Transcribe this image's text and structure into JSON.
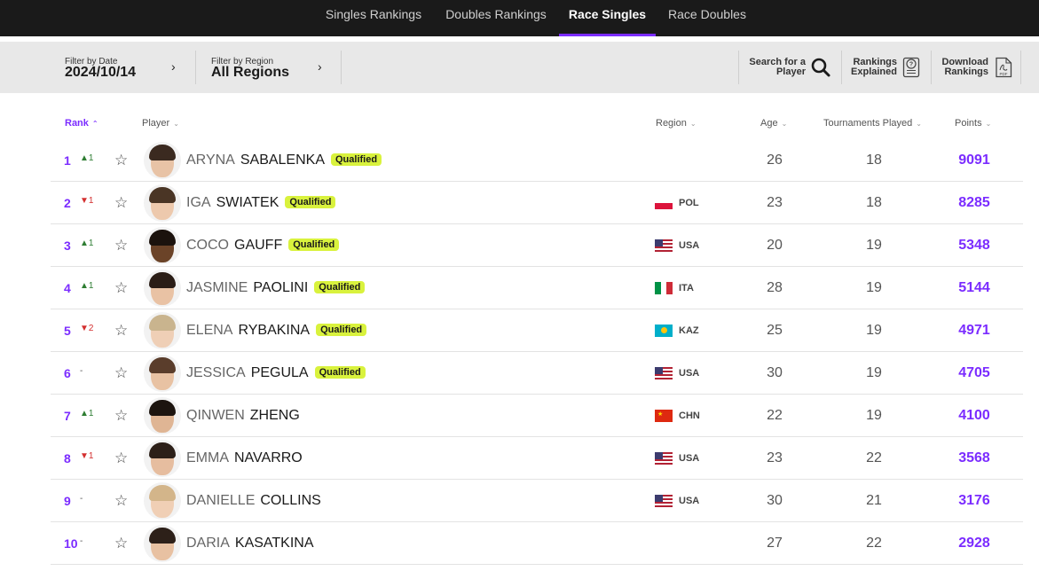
{
  "nav": {
    "tabs": [
      {
        "label": "Singles Rankings",
        "active": false
      },
      {
        "label": "Doubles Rankings",
        "active": false
      },
      {
        "label": "Race Singles",
        "active": true
      },
      {
        "label": "Race Doubles",
        "active": false
      }
    ],
    "accent_color": "#7b2cff"
  },
  "filters": {
    "date_label": "Filter by Date",
    "date_value": "2024/10/14",
    "region_label": "Filter by Region",
    "region_value": "All Regions"
  },
  "tools": {
    "search_line1": "Search for a",
    "search_line2": "Player",
    "explained_line1": "Rankings",
    "explained_line2": "Explained",
    "download_line1": "Download",
    "download_line2": "Rankings",
    "pdf_label": "PDF"
  },
  "columns": {
    "rank": "Rank",
    "player": "Player",
    "region": "Region",
    "age": "Age",
    "tournaments": "Tournaments Played",
    "points": "Points"
  },
  "qualified_label": "Qualified",
  "rows": [
    {
      "rank": "1",
      "move": "▲1",
      "dir": "up",
      "first": "ARYNA",
      "last": "SABALENKA",
      "qualified": true,
      "flag": "",
      "country": "",
      "age": "26",
      "tournaments": "18",
      "points": "9091"
    },
    {
      "rank": "2",
      "move": "▼1",
      "dir": "down",
      "first": "IGA",
      "last": "SWIATEK",
      "qualified": true,
      "flag": "pol",
      "country": "POL",
      "age": "23",
      "tournaments": "18",
      "points": "8285"
    },
    {
      "rank": "3",
      "move": "▲1",
      "dir": "up",
      "first": "COCO",
      "last": "GAUFF",
      "qualified": true,
      "flag": "usa",
      "country": "USA",
      "age": "20",
      "tournaments": "19",
      "points": "5348"
    },
    {
      "rank": "4",
      "move": "▲1",
      "dir": "up",
      "first": "JASMINE",
      "last": "PAOLINI",
      "qualified": true,
      "flag": "ita",
      "country": "ITA",
      "age": "28",
      "tournaments": "19",
      "points": "5144"
    },
    {
      "rank": "5",
      "move": "▼2",
      "dir": "down",
      "first": "ELENA",
      "last": "RYBAKINA",
      "qualified": true,
      "flag": "kaz",
      "country": "KAZ",
      "age": "25",
      "tournaments": "19",
      "points": "4971"
    },
    {
      "rank": "6",
      "move": "-",
      "dir": "same",
      "first": "JESSICA",
      "last": "PEGULA",
      "qualified": true,
      "flag": "usa",
      "country": "USA",
      "age": "30",
      "tournaments": "19",
      "points": "4705"
    },
    {
      "rank": "7",
      "move": "▲1",
      "dir": "up",
      "first": "QINWEN",
      "last": "ZHENG",
      "qualified": false,
      "flag": "chn",
      "country": "CHN",
      "age": "22",
      "tournaments": "19",
      "points": "4100"
    },
    {
      "rank": "8",
      "move": "▼1",
      "dir": "down",
      "first": "EMMA",
      "last": "NAVARRO",
      "qualified": false,
      "flag": "usa",
      "country": "USA",
      "age": "23",
      "tournaments": "22",
      "points": "3568"
    },
    {
      "rank": "9",
      "move": "-",
      "dir": "same",
      "first": "DANIELLE",
      "last": "COLLINS",
      "qualified": false,
      "flag": "usa",
      "country": "USA",
      "age": "30",
      "tournaments": "21",
      "points": "3176"
    },
    {
      "rank": "10",
      "move": "-",
      "dir": "same",
      "first": "DARIA",
      "last": "KASATKINA",
      "qualified": false,
      "flag": "",
      "country": "",
      "age": "27",
      "tournaments": "22",
      "points": "2928"
    }
  ]
}
